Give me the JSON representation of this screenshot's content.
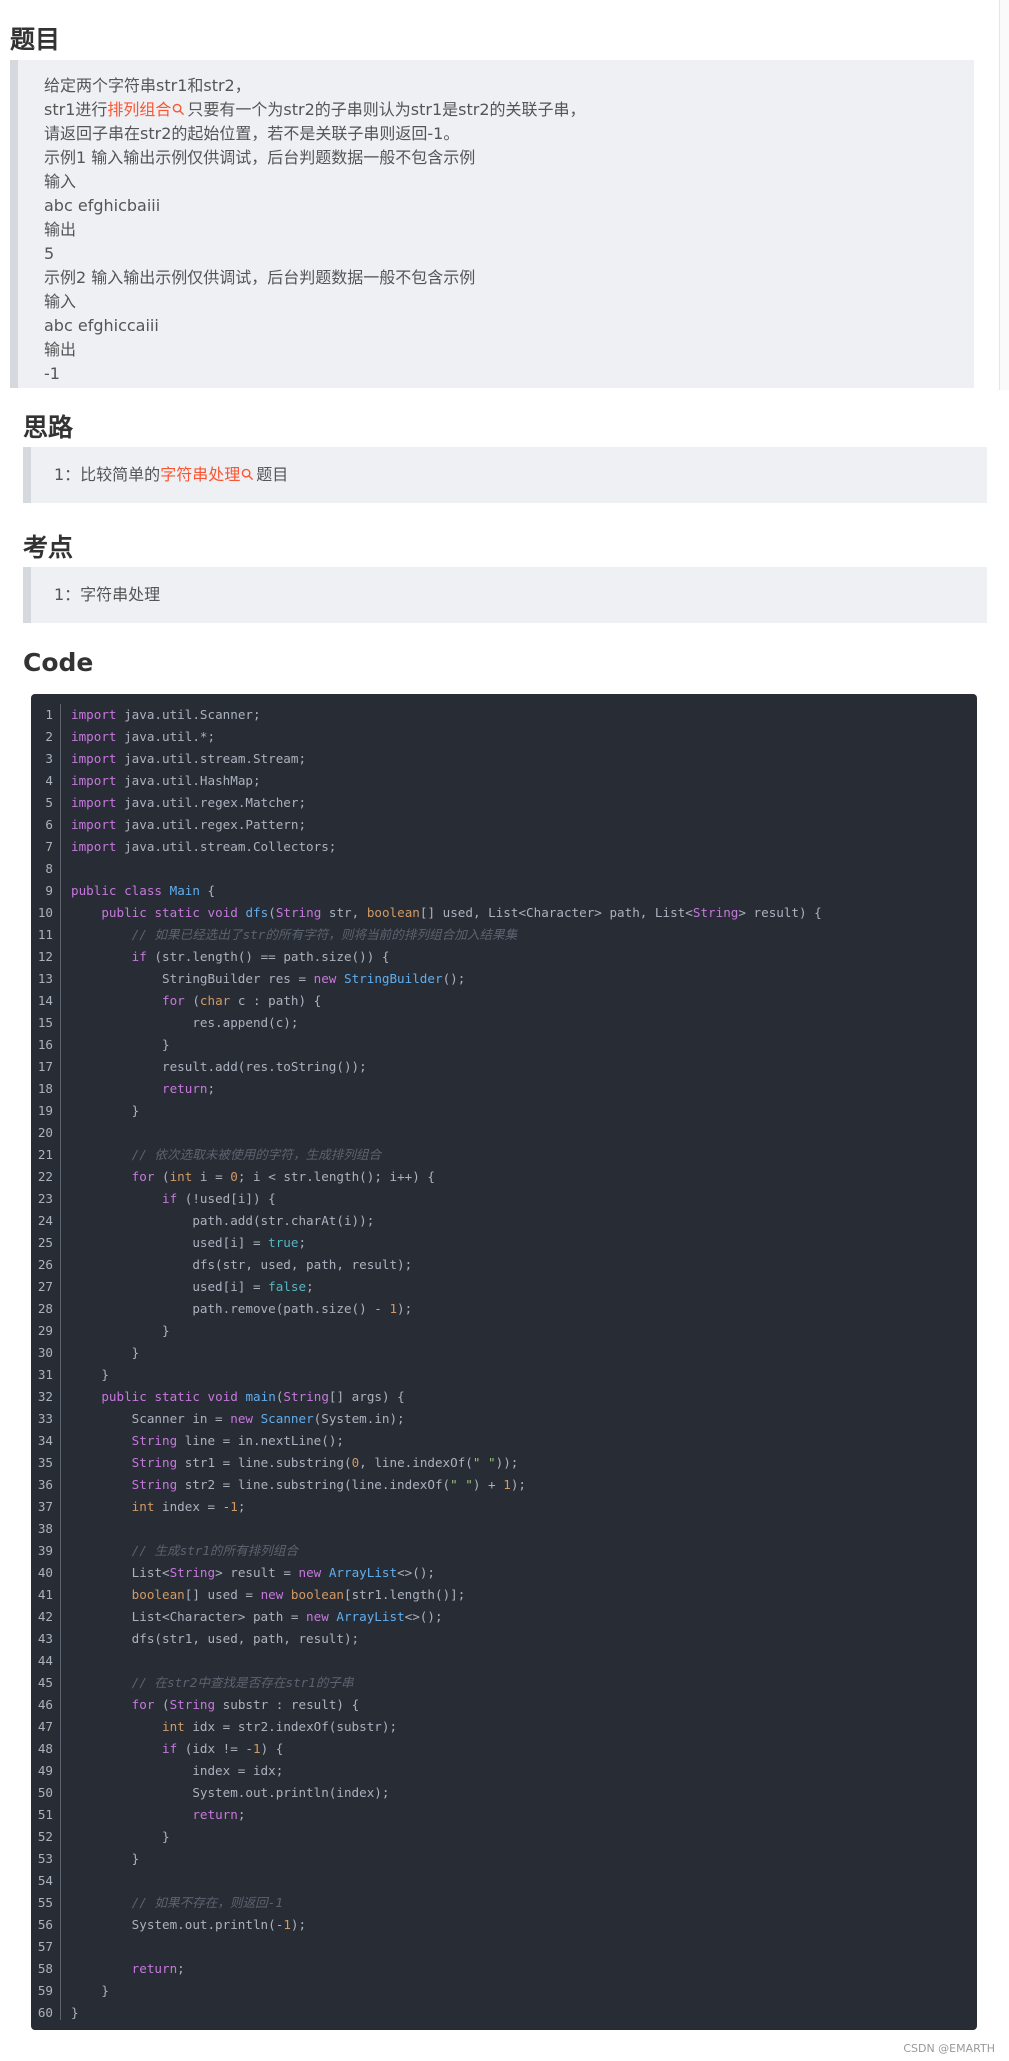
{
  "sections": {
    "problem": {
      "heading": "题目",
      "lines": [
        "给定两个字符串str1和str2，",
        "str1进行",
        "排列组合",
        "只要有一个为str2的子串则认为str1是str2的关联子串，",
        "请返回子串在str2的起始位置，若不是关联子串则返回-1。",
        "示例1 输入输出示例仅供调试，后台判题数据一般不包含示例",
        "输入",
        "abc efghicbaiii",
        "输出",
        "5",
        "示例2 输入输出示例仅供调试，后台判题数据一般不包含示例",
        "输入",
        "abc efghiccaiii",
        "输出",
        "-1"
      ]
    },
    "idea": {
      "heading": "思路",
      "prefix": "1：比较简单的",
      "link": "字符串处理",
      "suffix": "题目"
    },
    "point": {
      "heading": "考点",
      "text": "1：字符串处理"
    },
    "code": {
      "heading": "Code"
    }
  },
  "code_lines": [
    "import java.util.Scanner;",
    "import java.util.*;",
    "import java.util.stream.Stream;",
    "import java.util.HashMap;",
    "import java.util.regex.Matcher;",
    "import java.util.regex.Pattern;",
    "import java.util.stream.Collectors;",
    "",
    "public class Main {",
    "    public static void dfs(String str, boolean[] used, List<Character> path, List<String> result) {",
    "        // 如果已经选出了str的所有字符，则将当前的排列组合加入结果集",
    "        if (str.length() == path.size()) {",
    "            StringBuilder res = new StringBuilder();",
    "            for (char c : path) {",
    "                res.append(c);",
    "            }",
    "            result.add(res.toString());",
    "            return;",
    "        }",
    "",
    "        // 依次选取未被使用的字符，生成排列组合",
    "        for (int i = 0; i < str.length(); i++) {",
    "            if (!used[i]) {",
    "                path.add(str.charAt(i));",
    "                used[i] = true;",
    "                dfs(str, used, path, result);",
    "                used[i] = false;",
    "                path.remove(path.size() - 1);",
    "            }",
    "        }",
    "    }",
    "    public static void main(String[] args) {",
    "        Scanner in = new Scanner(System.in);",
    "        String line = in.nextLine();",
    "        String str1 = line.substring(0, line.indexOf(\" \"));",
    "        String str2 = line.substring(line.indexOf(\" \") + 1);",
    "        int index = -1;",
    "",
    "        // 生成str1的所有排列组合",
    "        List<String> result = new ArrayList<>();",
    "        boolean[] used = new boolean[str1.length()];",
    "        List<Character> path = new ArrayList<>();",
    "        dfs(str1, used, path, result);",
    "",
    "        // 在str2中查找是否存在str1的子串",
    "        for (String substr : result) {",
    "            int idx = str2.indexOf(substr);",
    "            if (idx != -1) {",
    "                index = idx;",
    "                System.out.println(index);",
    "                return;",
    "            }",
    "        }",
    "",
    "        // 如果不存在，则返回-1",
    "        System.out.println(-1);",
    "",
    "        return;",
    "    }",
    "}"
  ],
  "footer": "CSDN @EMARTH",
  "colors": {
    "link": "#fc5531",
    "code_bg": "#282c34",
    "quote_bg": "#eef0f4"
  }
}
